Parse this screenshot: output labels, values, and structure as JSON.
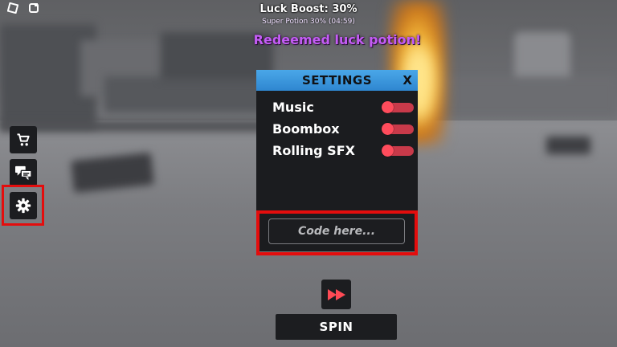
{
  "hud": {
    "luck_boost": "Luck Boost: 30%",
    "potion_timer": "Super Potion 30% (04:59)",
    "notification": "Redeemed luck potion!"
  },
  "sidebar": {
    "items": [
      {
        "icon": "cart-icon"
      },
      {
        "icon": "chat-icon"
      },
      {
        "icon": "gear-icon",
        "highlighted": true
      }
    ]
  },
  "settings": {
    "title": "SETTINGS",
    "close_label": "X",
    "options": [
      {
        "label": "Music",
        "enabled": false
      },
      {
        "label": "Boombox",
        "enabled": false
      },
      {
        "label": "Rolling SFX",
        "enabled": false
      }
    ],
    "code_placeholder": "Code here..."
  },
  "controls": {
    "spin_label": "SPIN",
    "fast_forward_icon": "fast-forward-icon"
  },
  "colors": {
    "highlight": "#e40d0d",
    "header": "#2e86d0",
    "toggle_off": "#c83a4a",
    "notification": "#c45cf5"
  }
}
